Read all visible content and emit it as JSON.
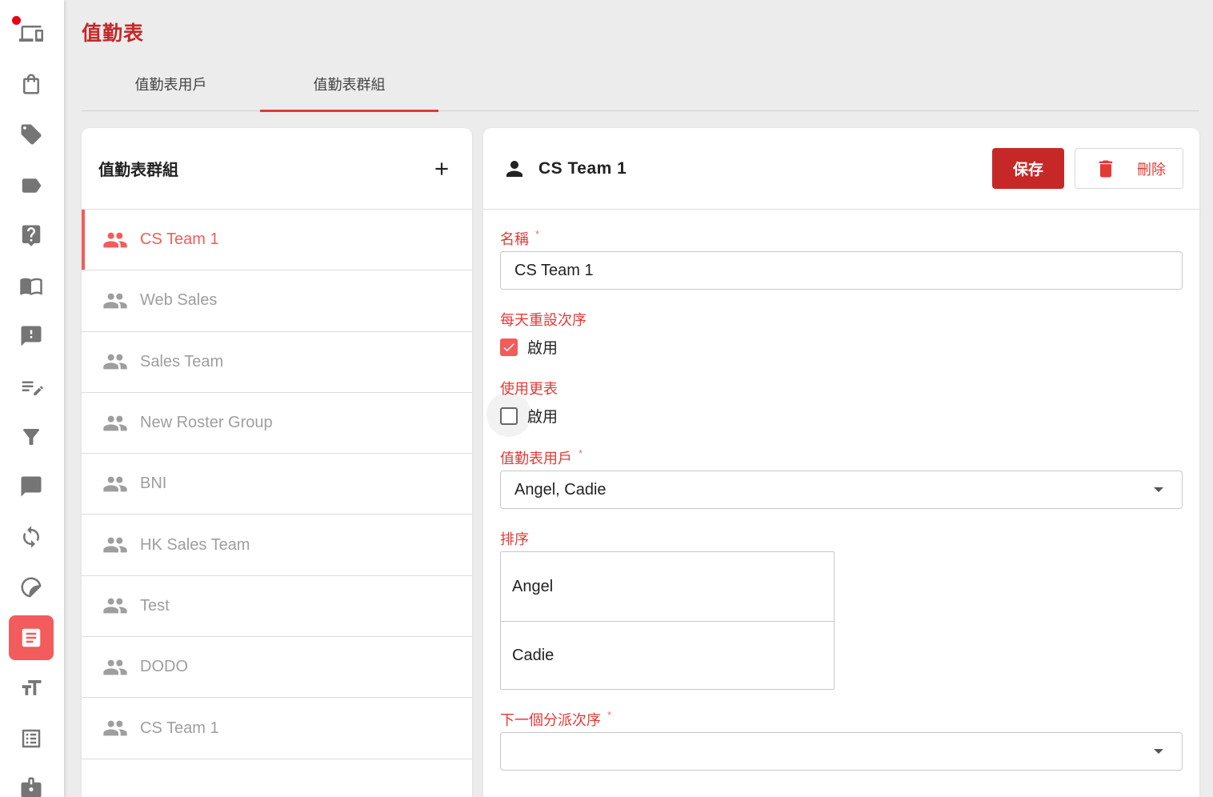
{
  "sidebar": {
    "items": [
      {
        "icon": "devices-icon",
        "notification": true
      },
      {
        "icon": "shopping-bag-icon"
      },
      {
        "icon": "tags-icon"
      },
      {
        "icon": "label-icon"
      },
      {
        "icon": "help-icon"
      },
      {
        "icon": "book-icon"
      },
      {
        "icon": "feedback-icon"
      },
      {
        "icon": "edit-list-icon"
      },
      {
        "icon": "filter-icon"
      },
      {
        "icon": "chat-icon"
      },
      {
        "icon": "sync-icon"
      },
      {
        "icon": "sticker-icon"
      },
      {
        "icon": "roster-icon",
        "active": true
      },
      {
        "icon": "text-size-icon"
      },
      {
        "icon": "list-alt-icon"
      },
      {
        "icon": "badge-icon"
      }
    ]
  },
  "header": {
    "title": "值勤表",
    "tabs": [
      {
        "label": "值勤表用戶",
        "active": false
      },
      {
        "label": "值勤表群組",
        "active": true
      }
    ]
  },
  "groups_panel": {
    "title": "值勤表群組",
    "items": [
      {
        "label": "CS Team 1",
        "active": true
      },
      {
        "label": "Web Sales"
      },
      {
        "label": "Sales Team"
      },
      {
        "label": "New Roster Group"
      },
      {
        "label": "BNI"
      },
      {
        "label": "HK Sales Team"
      },
      {
        "label": "Test"
      },
      {
        "label": "DODO"
      },
      {
        "label": "CS Team 1"
      }
    ]
  },
  "detail": {
    "name": "CS Team 1",
    "save_label": "保存",
    "delete_label": "刪除",
    "name_field": {
      "label": "名稱",
      "required": "*",
      "value": "CS Team 1"
    },
    "reset_daily": {
      "label": "每天重設次序",
      "checkbox_label": "啟用",
      "checked": true
    },
    "use_shift": {
      "label": "使用更表",
      "checkbox_label": "啟用",
      "checked": false
    },
    "roster_users": {
      "label": "值勤表用戶",
      "required": "*",
      "value": "Angel, Cadie"
    },
    "ordering": {
      "label": "排序",
      "items": [
        "Angel",
        "Cadie"
      ]
    },
    "next_assign": {
      "label": "下一個分派次序",
      "required": "*",
      "value": ""
    }
  },
  "colors": {
    "accent": "#f25c5c",
    "primary_dark": "#c62828"
  }
}
